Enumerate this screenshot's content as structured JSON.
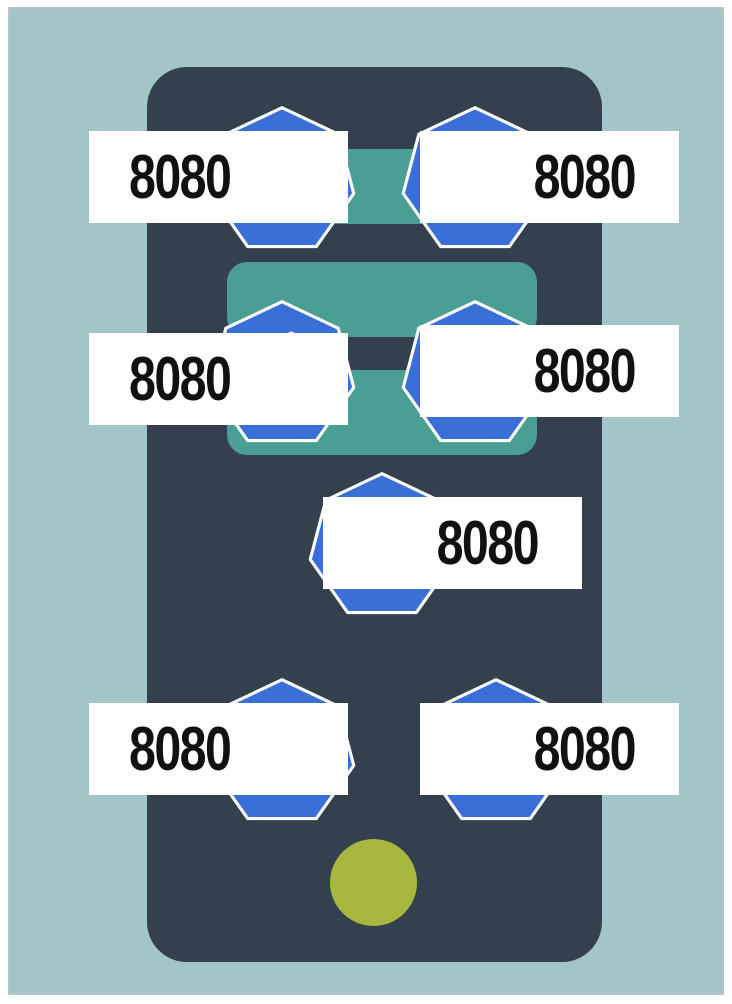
{
  "pods": [
    {
      "port": "8080",
      "label_side": "left"
    },
    {
      "port": "8080",
      "label_side": "right"
    },
    {
      "port": "8080",
      "label_side": "left"
    },
    {
      "port": "8080",
      "label_side": "right"
    },
    {
      "port": "8080",
      "label_side": "right"
    },
    {
      "port": "8080",
      "label_side": "left"
    },
    {
      "port": "8080",
      "label_side": "right"
    }
  ],
  "colors": {
    "background": "#a3c5c8",
    "server": "#34404d",
    "slot": "#4a9e94",
    "pod": "#3b6fd8",
    "led": "#a8b740",
    "label": "#ffffff"
  },
  "icons": {
    "pod": "kubernetes-pod-heptagon-cube-icon",
    "led": "status-light-icon"
  }
}
